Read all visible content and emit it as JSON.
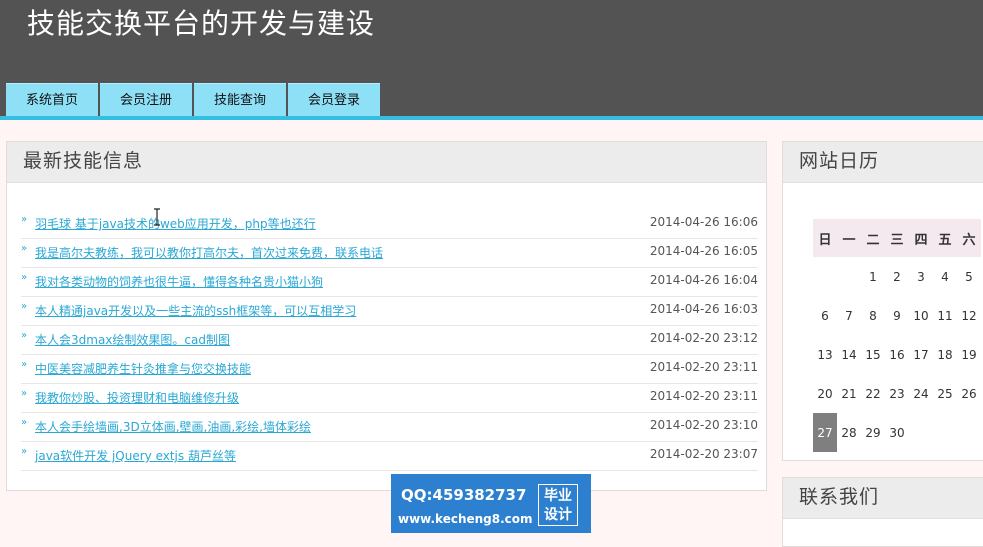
{
  "header": {
    "title": "技能交换平台的开发与建设",
    "nav": [
      "系统首页",
      "会员注册",
      "技能查询",
      "会员登录"
    ]
  },
  "news": {
    "title": "最新技能信息",
    "items": [
      {
        "text": "羽毛球  基于java技术的web应用开发，php等也还行",
        "date": "2014-04-26 16:06"
      },
      {
        "text": "我是高尔夫教练，我可以教你打高尔夫，首次过来免费，联系电话",
        "date": "2014-04-26 16:05"
      },
      {
        "text": "我对各类动物的饲养也很牛逼，懂得各种名贵小猫小狗",
        "date": "2014-04-26 16:04"
      },
      {
        "text": "本人精通java开发以及一些主流的ssh框架等，可以互相学习",
        "date": "2014-04-26 16:03"
      },
      {
        "text": "本人会3dmax绘制效果图。cad制图",
        "date": "2014-02-20 23:12"
      },
      {
        "text": "中医美容减肥养生针灸推拿与您交换技能",
        "date": "2014-02-20 23:11"
      },
      {
        "text": "我教你炒股、投资理财和电脑维修升级",
        "date": "2014-02-20 23:11"
      },
      {
        "text": "本人会手绘墙画,3D立体画,壁画,油画,彩绘,墙体彩绘",
        "date": "2014-02-20 23:10"
      },
      {
        "text": "java软件开发  jQuery extjs 葫芦丝等",
        "date": "2014-02-20 23:07"
      }
    ]
  },
  "calendar": {
    "title": "网站日历",
    "weekdays": [
      "日",
      "一",
      "二",
      "三",
      "四",
      "五",
      "六"
    ],
    "weeks": [
      [
        "",
        "",
        "1",
        "2",
        "3",
        "4",
        "5"
      ],
      [
        "6",
        "7",
        "8",
        "9",
        "10",
        "11",
        "12"
      ],
      [
        "13",
        "14",
        "15",
        "16",
        "17",
        "18",
        "19"
      ],
      [
        "20",
        "21",
        "22",
        "23",
        "24",
        "25",
        "26"
      ],
      [
        "27",
        "28",
        "29",
        "30",
        "",
        "",
        ""
      ]
    ],
    "today": "27"
  },
  "contact": {
    "title": "联系我们"
  },
  "watermark": {
    "qq": "QQ:459382737",
    "url": "www.kecheng8.com",
    "badge_line1": "毕业",
    "badge_line2": "设计"
  }
}
